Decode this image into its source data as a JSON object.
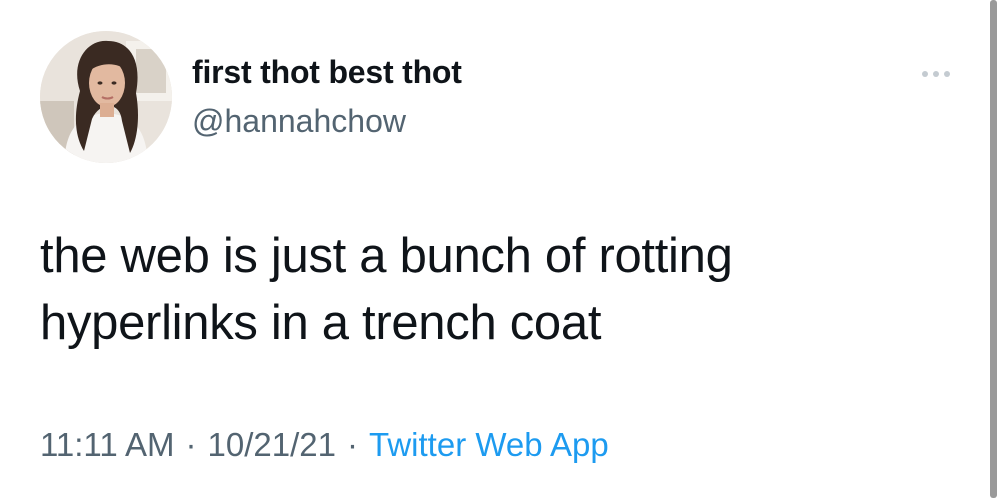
{
  "user": {
    "display_name": "first thot best thot",
    "handle": "@hannahchow"
  },
  "tweet": {
    "text_line1": "the web is just a bunch of rotting",
    "text_line2": "hyperlinks in a trench coat",
    "time": "11:11 AM",
    "date": "10/21/21",
    "source": "Twitter Web App",
    "separator": "·"
  },
  "icons": {
    "more": "more-horizontal-icon",
    "avatar": "avatar-photo"
  },
  "colors": {
    "text_primary": "#0f1419",
    "text_secondary": "#536471",
    "link": "#1d9bf0",
    "background": "#ffffff"
  }
}
